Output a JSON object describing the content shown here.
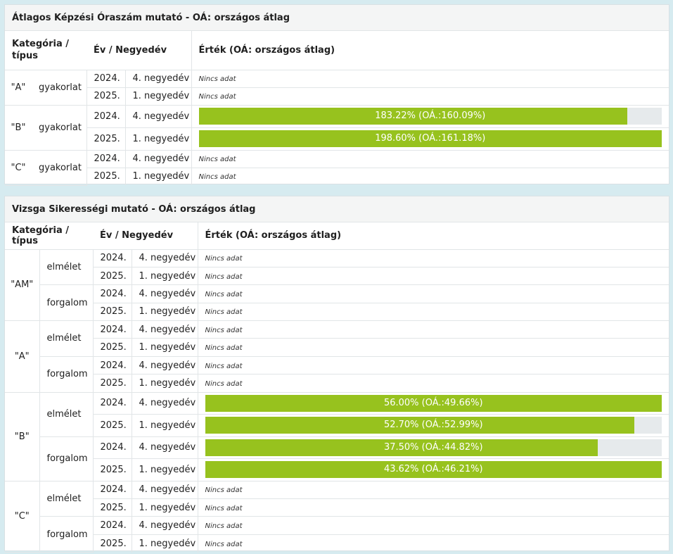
{
  "panel1": {
    "title": "Átlagos Képzési Óraszám mutató - OÁ: országos átlag",
    "headers": {
      "category": "Kategória / típus",
      "period": "Év / Negyedév",
      "value": "Érték (OÁ: országos átlag)"
    },
    "rows": [
      {
        "cat": "\"A\"",
        "sub": "gyakorlat",
        "year": "2024.",
        "q": "4. negyedév",
        "value": "Nincs adat"
      },
      {
        "cat": "\"A\"",
        "sub": "gyakorlat",
        "year": "2025.",
        "q": "1. negyedév",
        "value": "Nincs adat"
      },
      {
        "cat": "\"B\"",
        "sub": "gyakorlat",
        "year": "2024.",
        "q": "4. negyedév",
        "value": "183.22% (OÁ.:160.09%)",
        "fill": 0.925
      },
      {
        "cat": "\"B\"",
        "sub": "gyakorlat",
        "year": "2025.",
        "q": "1. negyedév",
        "value": "198.60% (OÁ.:161.18%)",
        "fill": 1.0
      },
      {
        "cat": "\"C\"",
        "sub": "gyakorlat",
        "year": "2024.",
        "q": "4. negyedév",
        "value": "Nincs adat"
      },
      {
        "cat": "\"C\"",
        "sub": "gyakorlat",
        "year": "2025.",
        "q": "1. negyedév",
        "value": "Nincs adat"
      }
    ]
  },
  "panel2": {
    "title": "Vizsga Sikerességi mutató - OÁ: országos átlag",
    "headers": {
      "category": "Kategória / típus",
      "period": "Év / Negyedév",
      "value": "Érték (OÁ: országos átlag)"
    },
    "rows": [
      {
        "cat": "\"AM\"",
        "sub": "elmélet",
        "year": "2024.",
        "q": "4. negyedév",
        "value": "Nincs adat"
      },
      {
        "cat": "\"AM\"",
        "sub": "elmélet",
        "year": "2025.",
        "q": "1. negyedév",
        "value": "Nincs adat"
      },
      {
        "cat": "\"AM\"",
        "sub": "forgalom",
        "year": "2024.",
        "q": "4. negyedév",
        "value": "Nincs adat"
      },
      {
        "cat": "\"AM\"",
        "sub": "forgalom",
        "year": "2025.",
        "q": "1. negyedév",
        "value": "Nincs adat"
      },
      {
        "cat": "\"A\"",
        "sub": "elmélet",
        "year": "2024.",
        "q": "4. negyedév",
        "value": "Nincs adat"
      },
      {
        "cat": "\"A\"",
        "sub": "elmélet",
        "year": "2025.",
        "q": "1. negyedév",
        "value": "Nincs adat"
      },
      {
        "cat": "\"A\"",
        "sub": "forgalom",
        "year": "2024.",
        "q": "4. negyedév",
        "value": "Nincs adat"
      },
      {
        "cat": "\"A\"",
        "sub": "forgalom",
        "year": "2025.",
        "q": "1. negyedév",
        "value": "Nincs adat"
      },
      {
        "cat": "\"B\"",
        "sub": "elmélet",
        "year": "2024.",
        "q": "4. negyedév",
        "value": "56.00% (OÁ.:49.66%)",
        "fill": 1.0
      },
      {
        "cat": "\"B\"",
        "sub": "elmélet",
        "year": "2025.",
        "q": "1. negyedév",
        "value": "52.70% (OÁ.:52.99%)",
        "fill": 0.94
      },
      {
        "cat": "\"B\"",
        "sub": "forgalom",
        "year": "2024.",
        "q": "4. negyedév",
        "value": "37.50% (OÁ.:44.82%)",
        "fill": 0.86
      },
      {
        "cat": "\"B\"",
        "sub": "forgalom",
        "year": "2025.",
        "q": "1. negyedév",
        "value": "43.62% (OÁ.:46.21%)",
        "fill": 1.0
      },
      {
        "cat": "\"C\"",
        "sub": "elmélet",
        "year": "2024.",
        "q": "4. negyedév",
        "value": "Nincs adat"
      },
      {
        "cat": "\"C\"",
        "sub": "elmélet",
        "year": "2025.",
        "q": "1. negyedév",
        "value": "Nincs adat"
      },
      {
        "cat": "\"C\"",
        "sub": "forgalom",
        "year": "2024.",
        "q": "4. negyedév",
        "value": "Nincs adat"
      },
      {
        "cat": "\"C\"",
        "sub": "forgalom",
        "year": "2025.",
        "q": "1. negyedév",
        "value": "Nincs adat"
      }
    ]
  },
  "colors": {
    "bar_fill": "#97c21e",
    "bar_track": "#e6eaec",
    "background": "#d6ebf0"
  }
}
